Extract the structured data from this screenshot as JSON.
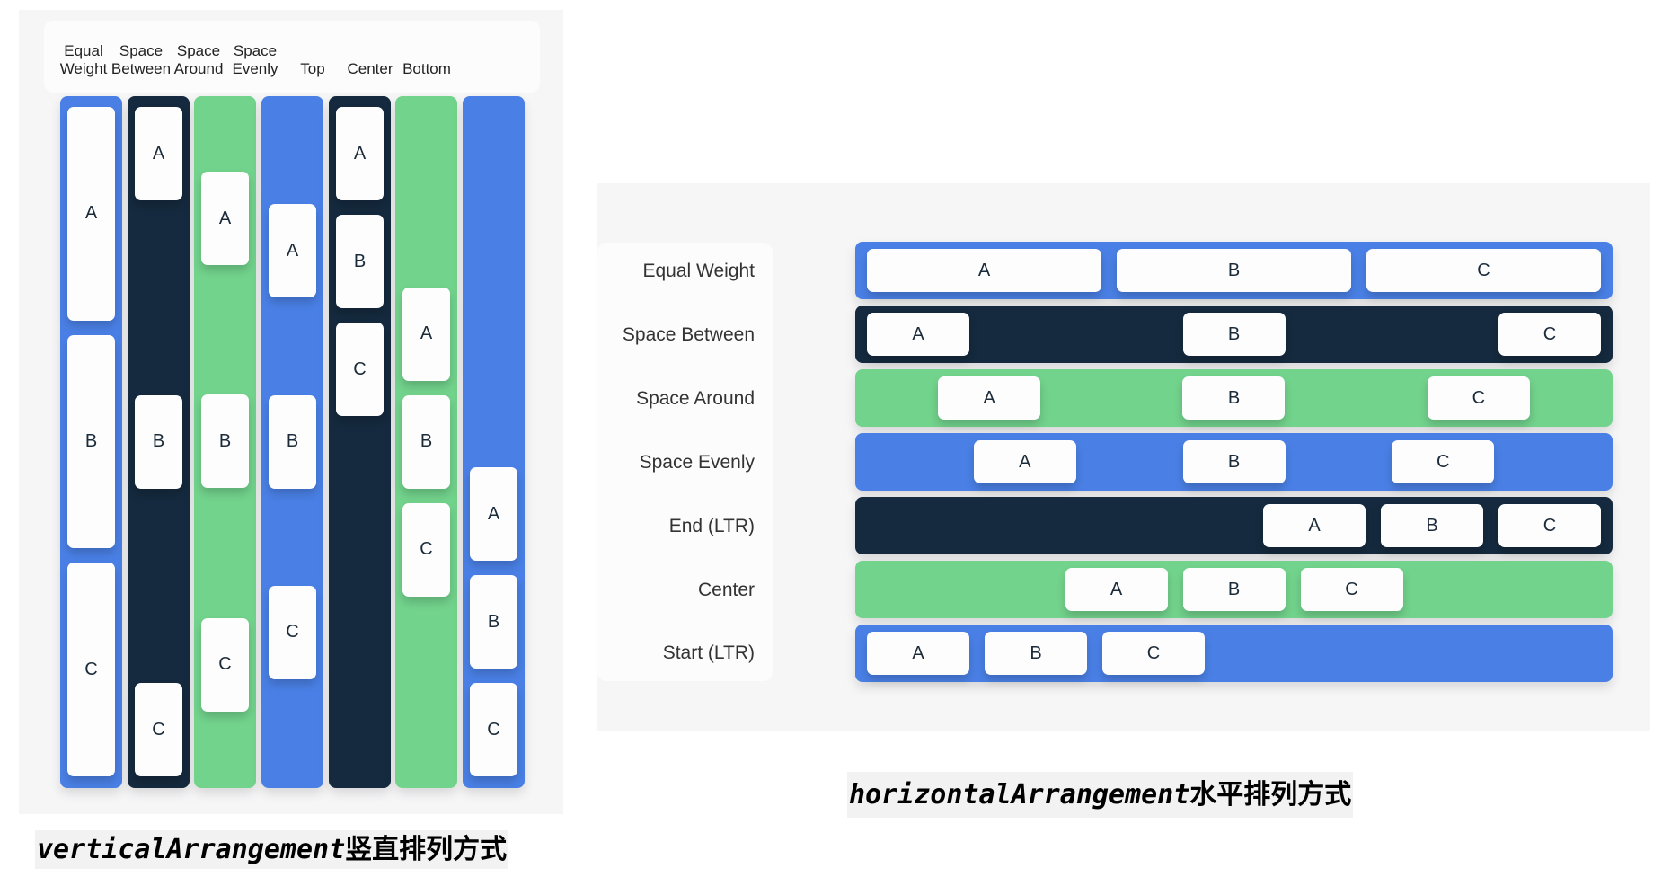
{
  "colors": {
    "blue": "#4a80e6",
    "dark": "#152a3e",
    "green": "#72d38c",
    "card": "#fdfdfe",
    "panel": "#f6f6f7"
  },
  "vertical": {
    "caption_code": "verticalArrangement",
    "caption_text": "竖直排列方式",
    "columns": [
      {
        "label": "Equal\nWeight",
        "mode": "equal-weight",
        "color": "blue",
        "items": [
          "A",
          "B",
          "C"
        ]
      },
      {
        "label": "Space\nBetween",
        "mode": "space-between",
        "color": "dark",
        "items": [
          "A",
          "B",
          "C"
        ]
      },
      {
        "label": "Space\nAround",
        "mode": "space-around",
        "color": "green",
        "items": [
          "A",
          "B",
          "C"
        ]
      },
      {
        "label": "Space\nEvenly",
        "mode": "space-evenly",
        "color": "blue",
        "items": [
          "A",
          "B",
          "C"
        ]
      },
      {
        "label": "Top",
        "mode": "top",
        "color": "dark",
        "items": [
          "A",
          "B",
          "C"
        ]
      },
      {
        "label": "Center",
        "mode": "center",
        "color": "green",
        "items": [
          "A",
          "B",
          "C"
        ]
      },
      {
        "label": "Bottom",
        "mode": "bottom",
        "color": "blue",
        "items": [
          "A",
          "B",
          "C"
        ]
      }
    ]
  },
  "horizontal": {
    "caption_code": "horizontalArrangement",
    "caption_text": "水平排列方式",
    "rows": [
      {
        "label": "Equal Weight",
        "mode": "equal-weight",
        "color": "blue",
        "items": [
          "A",
          "B",
          "C"
        ]
      },
      {
        "label": "Space Between",
        "mode": "space-between",
        "color": "dark",
        "items": [
          "A",
          "B",
          "C"
        ]
      },
      {
        "label": "Space Around",
        "mode": "space-around",
        "color": "green",
        "items": [
          "A",
          "B",
          "C"
        ]
      },
      {
        "label": "Space Evenly",
        "mode": "space-evenly",
        "color": "blue",
        "items": [
          "A",
          "B",
          "C"
        ]
      },
      {
        "label": "End (LTR)",
        "mode": "end",
        "color": "dark",
        "items": [
          "A",
          "B",
          "C"
        ]
      },
      {
        "label": "Center",
        "mode": "center",
        "color": "green",
        "items": [
          "A",
          "B",
          "C"
        ]
      },
      {
        "label": "Start (LTR)",
        "mode": "start",
        "color": "blue",
        "items": [
          "A",
          "B",
          "C"
        ]
      }
    ]
  }
}
